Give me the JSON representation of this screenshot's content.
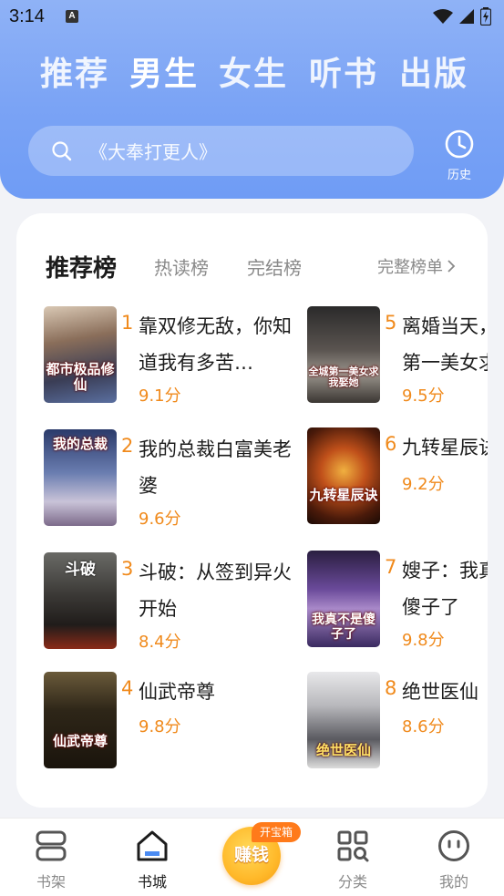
{
  "status_bar": {
    "time": "3:14",
    "notification_letter": "A"
  },
  "top_tabs": [
    {
      "label": "推荐",
      "active": false
    },
    {
      "label": "男生",
      "active": true
    },
    {
      "label": "女生",
      "active": false
    },
    {
      "label": "听书",
      "active": false
    },
    {
      "label": "出版",
      "active": false
    }
  ],
  "search": {
    "placeholder": "《大奉打更人》"
  },
  "history": {
    "label": "历史"
  },
  "rank_tabs": [
    {
      "label": "推荐榜",
      "active": true
    },
    {
      "label": "热读榜",
      "active": false
    },
    {
      "label": "完结榜",
      "active": false
    }
  ],
  "full_list_label": "完整榜单",
  "books": [
    {
      "rank": "1",
      "title": "靠双修无敌，你知道我有多苦…",
      "score": "9.1分",
      "cover_text": "都市极品修仙"
    },
    {
      "rank": "2",
      "title": "我的总裁白富美老婆",
      "score": "9.6分",
      "cover_text": "我的总裁"
    },
    {
      "rank": "3",
      "title": "斗破：从签到异火开始",
      "score": "8.4分",
      "cover_text": "斗破"
    },
    {
      "rank": "4",
      "title": "仙武帝尊",
      "score": "9.8分",
      "cover_text": "仙武帝尊"
    },
    {
      "rank": "5",
      "title": "离婚当天，",
      "title_line2": "第一美女求",
      "score": "9.5分",
      "cover_text": "全城第一美女求我娶她"
    },
    {
      "rank": "6",
      "title": "九转星辰诀",
      "score": "9.2分",
      "cover_text": "九转星辰诀"
    },
    {
      "rank": "7",
      "title": "嫂子：我真",
      "title_line2": "傻子了",
      "score": "9.8分",
      "cover_text": "我真不是傻子了"
    },
    {
      "rank": "8",
      "title": "绝世医仙",
      "score": "8.6分",
      "cover_text": "绝世医仙"
    }
  ],
  "bottom_nav": [
    {
      "label": "书架",
      "active": false
    },
    {
      "label": "书城",
      "active": true
    },
    {
      "label": "分类",
      "active": false
    },
    {
      "label": "我的",
      "active": false
    }
  ],
  "earn": {
    "label": "赚钱",
    "badge": "开宝箱"
  },
  "colors": {
    "accent": "#f08a1c",
    "header": "#7aa3f5"
  }
}
